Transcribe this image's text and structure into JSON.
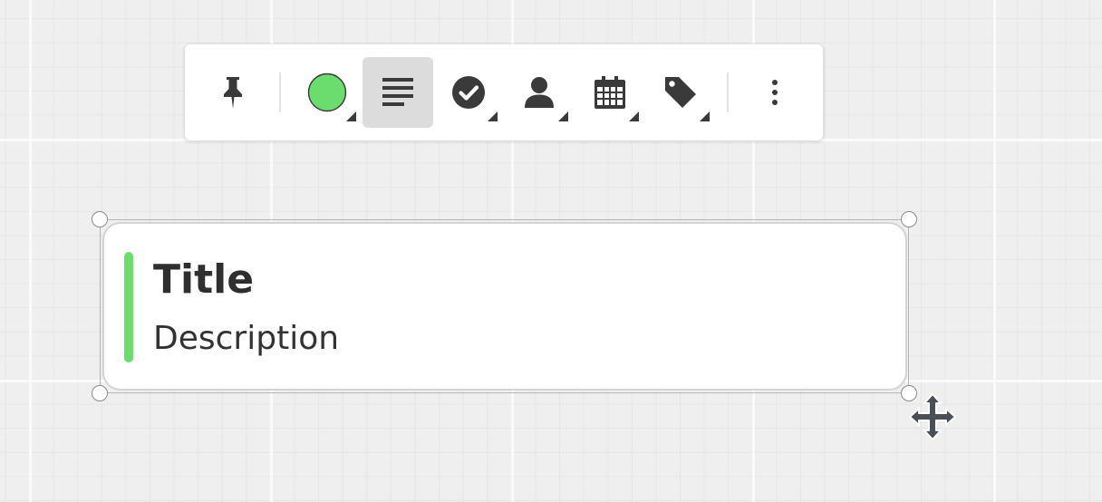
{
  "toolbar": {
    "buttons": [
      {
        "name": "pin",
        "icon": "pushpin-icon",
        "dropdown": false,
        "active": false
      },
      {
        "name": "color",
        "icon": "color-circle-icon",
        "dropdown": true,
        "active": false,
        "swatch_color": "#6bdd6f"
      },
      {
        "name": "description",
        "icon": "text-lines-icon",
        "dropdown": false,
        "active": true
      },
      {
        "name": "status",
        "icon": "check-circle-icon",
        "dropdown": true,
        "active": false
      },
      {
        "name": "assignee",
        "icon": "person-icon",
        "dropdown": true,
        "active": false
      },
      {
        "name": "date",
        "icon": "calendar-icon",
        "dropdown": true,
        "active": false
      },
      {
        "name": "tag",
        "icon": "tag-icon",
        "dropdown": true,
        "active": false
      },
      {
        "name": "more",
        "icon": "more-vertical-icon",
        "dropdown": false,
        "active": false
      }
    ]
  },
  "card": {
    "title": "Title",
    "description": "Description",
    "accent_color": "#6bdd6f"
  },
  "colors": {
    "icon": "#3a3a3a",
    "canvas": "#efefef",
    "active_button": "#dcdcdc"
  }
}
